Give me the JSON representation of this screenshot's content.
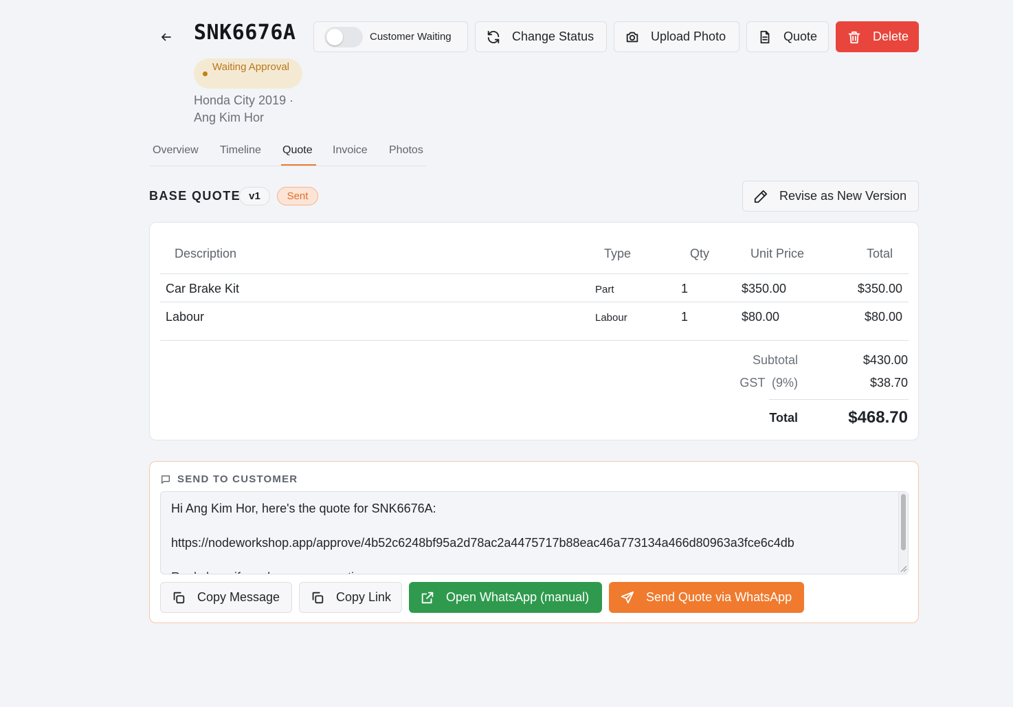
{
  "header": {
    "plate": "SNK6676A",
    "status": "Waiting Approval",
    "vehicle_line": "Honda City 2019 ·",
    "customer_line": "Ang Kim Hor"
  },
  "toolbar": {
    "customer_waiting_label": "Customer Waiting",
    "customer_waiting_on": false,
    "change_status_label": "Change Status",
    "upload_photo_label": "Upload Photo",
    "quote_label": "Quote",
    "delete_label": "Delete"
  },
  "tabs": [
    {
      "label": "Overview",
      "active": false
    },
    {
      "label": "Timeline",
      "active": false
    },
    {
      "label": "Quote",
      "active": true
    },
    {
      "label": "Invoice",
      "active": false
    },
    {
      "label": "Photos",
      "active": false
    }
  ],
  "quote": {
    "title": "BASE QUOTE",
    "version": "v1",
    "state": "Sent",
    "revise_label": "Revise as New Version",
    "columns": [
      "Description",
      "Type",
      "Qty",
      "Unit Price",
      "Total"
    ],
    "rows": [
      {
        "description": "Car Brake Kit",
        "type": "Part",
        "qty": "1",
        "unit_price": "$350.00",
        "total": "$350.00"
      },
      {
        "description": "Labour",
        "type": "Labour",
        "qty": "1",
        "unit_price": "$80.00",
        "total": "$80.00"
      }
    ],
    "subtotal_label": "Subtotal",
    "subtotal": "$430.00",
    "gst_label": "GST  (9%)",
    "gst": "$38.70",
    "total_label": "Total",
    "total": "$468.70"
  },
  "send": {
    "title": "SEND TO CUSTOMER",
    "message": "Hi Ang Kim Hor, here's the quote for SNK6676A:\n\nhttps://nodeworkshop.app/approve/4b52c6248bf95a2d78ac2a4475717b88eac46a773134a466d80963a3fce6c4db\n\nReply here if you have any questions.",
    "copy_message_label": "Copy Message",
    "copy_link_label": "Copy Link",
    "open_whatsapp_label": "Open WhatsApp (manual)",
    "send_whatsapp_label": "Send Quote via WhatsApp"
  },
  "colors": {
    "accent": "#f07a2d",
    "danger": "#e8453c",
    "whatsapp": "#2f9a4d",
    "status_waiting": "#b9771b"
  }
}
